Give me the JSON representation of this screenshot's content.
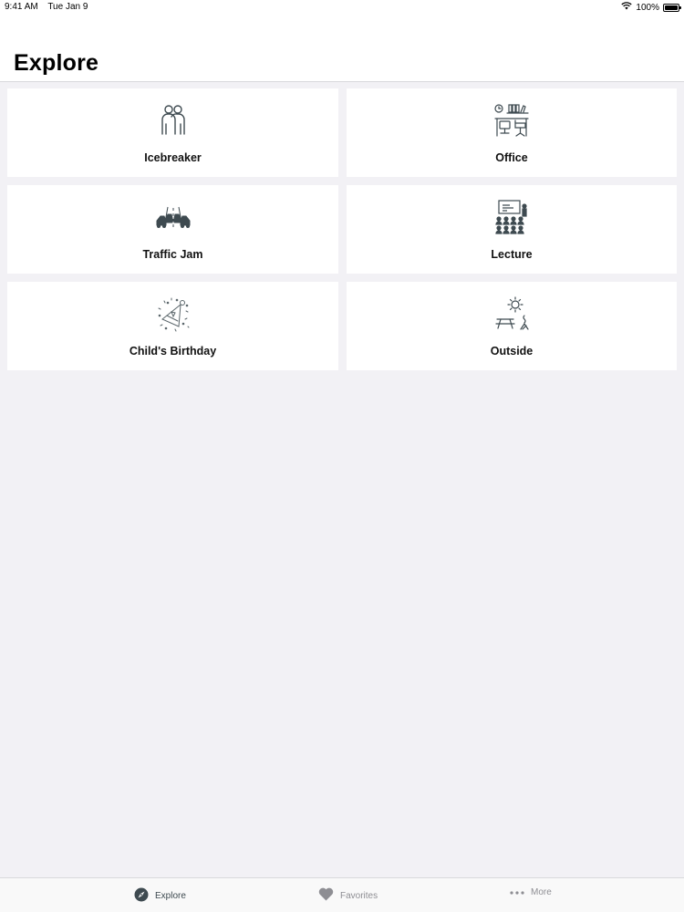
{
  "status": {
    "time": "9:41 AM",
    "date": "Tue Jan 9",
    "battery_text": "100%",
    "battery_level": 1.0
  },
  "header": {
    "title": "Explore"
  },
  "categories": [
    {
      "label": "Icebreaker",
      "icon": "two-people-icon"
    },
    {
      "label": "Office",
      "icon": "office-desk-icon"
    },
    {
      "label": "Traffic Jam",
      "icon": "traffic-jam-icon"
    },
    {
      "label": "Lecture",
      "icon": "lecture-hall-icon"
    },
    {
      "label": "Child's Birthday",
      "icon": "party-hat-icon"
    },
    {
      "label": "Outside",
      "icon": "picnic-sun-icon"
    }
  ],
  "tabbar": {
    "explore": {
      "label": "Explore",
      "icon": "compass-icon",
      "selected": true
    },
    "favorites": {
      "label": "Favorites",
      "icon": "heart-icon",
      "selected": false
    },
    "more": {
      "label": "More",
      "icon": "more-dots-icon",
      "selected": false
    }
  },
  "colors": {
    "accent": "#3e4a50",
    "inactive": "#8e8e93",
    "background": "#f2f1f5",
    "card": "#ffffff"
  }
}
